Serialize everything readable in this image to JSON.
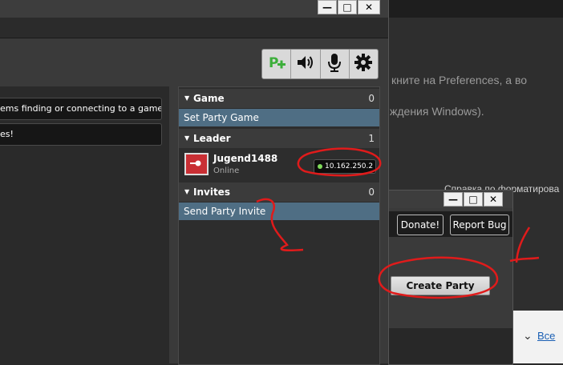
{
  "background_page": {
    "line1": "кните на Preferences, а во",
    "line2": "ждения Windows).",
    "format_link": "Справка по форматирова",
    "bottom_link": "Все"
  },
  "toolbar": {
    "icons": [
      "add-party-icon",
      "speaker-icon",
      "microphone-icon",
      "gear-icon"
    ]
  },
  "messages": [
    "ems finding or connecting to a game.",
    "es!"
  ],
  "party": {
    "game": {
      "label": "Game",
      "count": "0",
      "action": "Set Party Game"
    },
    "leader": {
      "label": "Leader",
      "count": "1",
      "name": "Jugend1488",
      "status": "Online",
      "ip": "10.162.250.2"
    },
    "invites": {
      "label": "Invites",
      "count": "0",
      "action": "Send Party Invite"
    }
  },
  "dialog": {
    "donate_label": "Donate!",
    "report_label": "Report Bug",
    "create_party_label": "Create Party"
  },
  "window_buttons": {
    "minimize": "—",
    "maximize": "□",
    "close": "✕"
  },
  "annotations": {
    "color": "#e01b1b",
    "numbers": [
      "1",
      "2"
    ]
  }
}
